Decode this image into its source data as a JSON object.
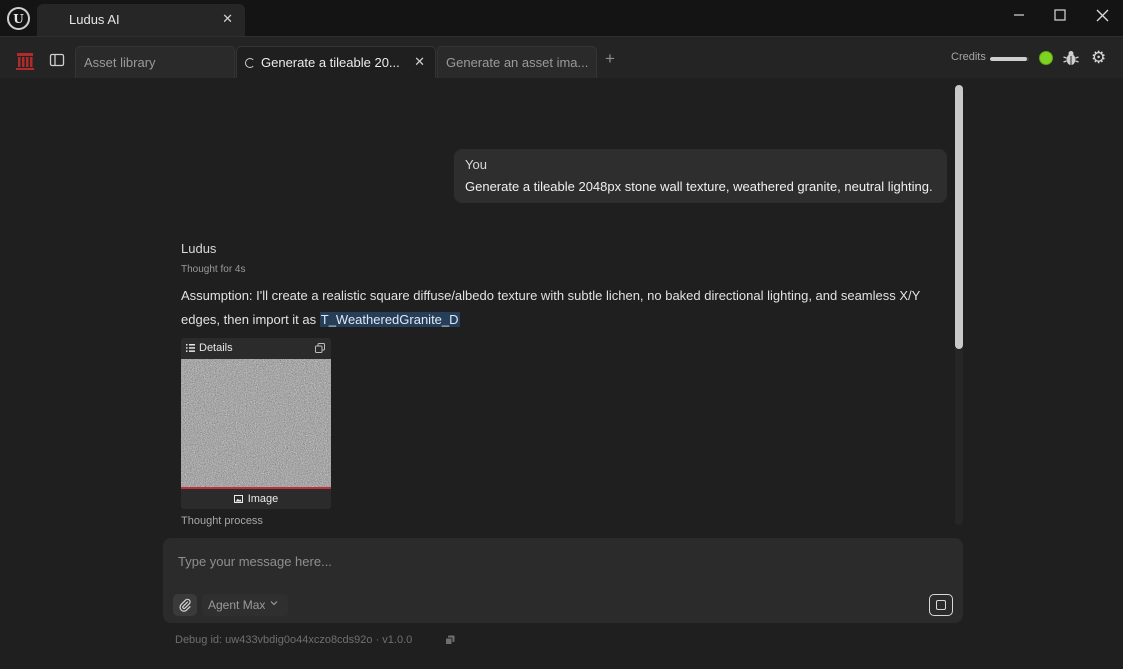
{
  "window": {
    "tab_title": "Ludus AI",
    "close_symbol": "✕",
    "controls": {
      "minimize": "minimize-icon",
      "maximize": "maximize-icon",
      "close": "close-icon"
    }
  },
  "toolbar": {
    "tabs": [
      {
        "label": "Asset library",
        "active": false
      },
      {
        "label": "Generate a tileable 20...",
        "active": true,
        "loading": true
      },
      {
        "label": "Generate an asset ima...",
        "active": false
      }
    ],
    "tab_close": "✕",
    "new_tab": "+",
    "credits_label": "Credits",
    "credits_level": 0.95,
    "status_color": "#7ed321"
  },
  "chat": {
    "user": {
      "name": "You",
      "text": "Generate a tileable 2048px stone wall texture, weathered granite, neutral lighting."
    },
    "assistant": {
      "name": "Ludus",
      "thought_time": "Thought for 4s",
      "text_before": "Assumption: I'll create a realistic square diffuse/albedo texture with subtle lichen, no baked directional lighting, and seamless X/Y edges, then import it as ",
      "asset_name": "T_WeatheredGranite_D",
      "details_label": "Details",
      "image_label": "Image",
      "thought_process": "Thought process"
    }
  },
  "composer": {
    "placeholder": "Type your message here...",
    "agent": "Agent Max"
  },
  "footer": {
    "debug": "Debug id: uw433vbdig0o44xczo8cds92o · v1.0.0"
  }
}
